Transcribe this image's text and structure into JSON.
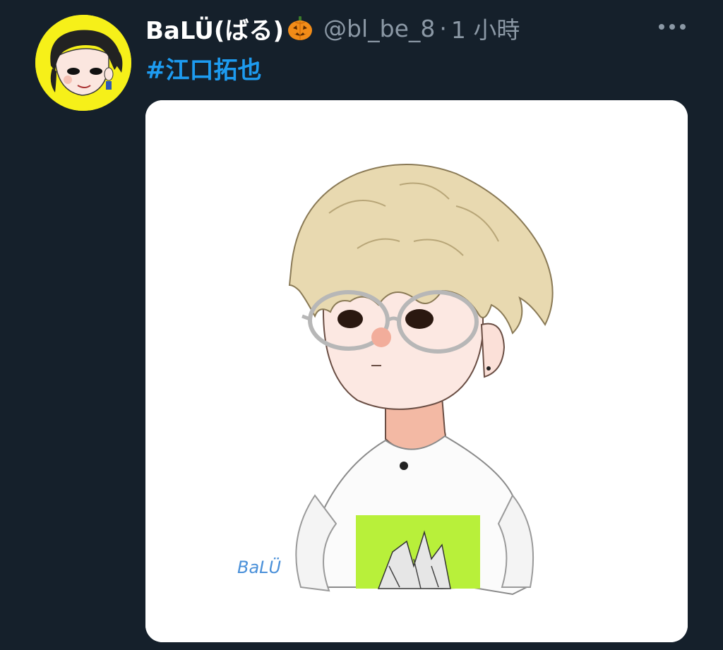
{
  "user": {
    "display_name": "BaLÜ(ばる)",
    "handle": "@bl_be_8",
    "separator": "·",
    "time": "1 小時"
  },
  "tweet": {
    "hashtag": "#江口拓也"
  },
  "media": {
    "signature": "BaLÜ"
  },
  "icons": {
    "name_emoji": "jack-o-lantern-icon",
    "menu": "more-icon"
  },
  "colors": {
    "background": "#15202b",
    "accent": "#1d9bf0",
    "muted": "#8b98a5",
    "avatar_bg": "#f6f019"
  }
}
